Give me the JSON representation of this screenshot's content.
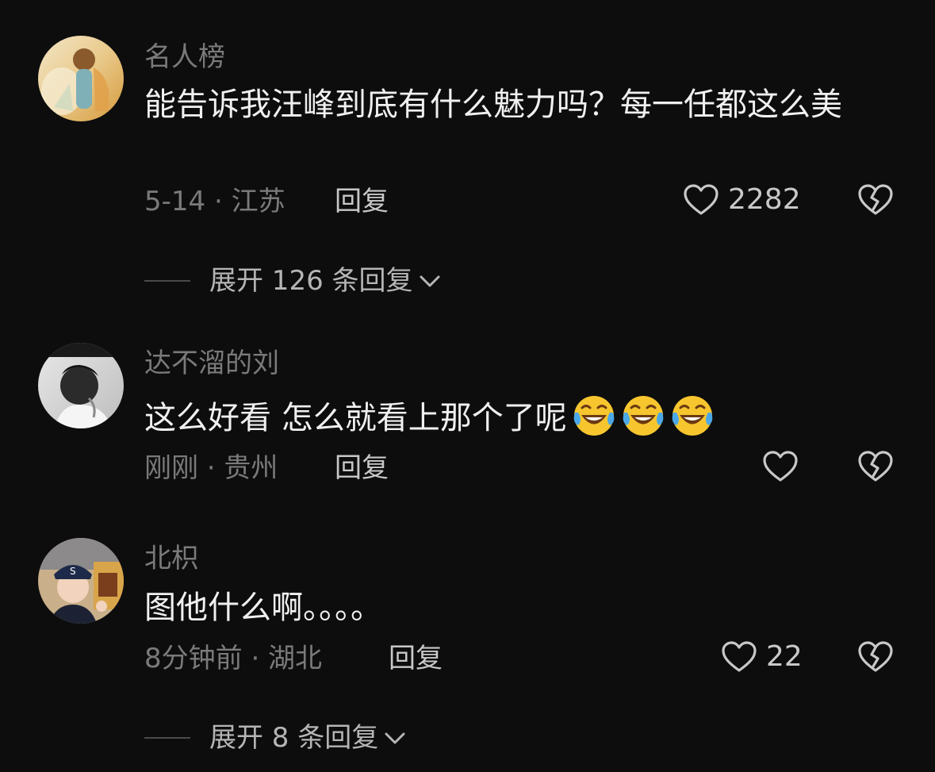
{
  "comments": [
    {
      "username": "名人榜",
      "text": "能告诉我汪峰到底有什么魅力吗？每一任都这么美",
      "meta": "5-14 · 江苏",
      "reply_label": "回复",
      "likes": "2282",
      "expand_label": "展开 126 条回复"
    },
    {
      "username": "达不溜的刘",
      "text": "这么好看 怎么就看上那个了呢",
      "emojis": [
        "laughing-crying-emoji",
        "laughing-crying-emoji",
        "laughing-crying-emoji"
      ],
      "meta": "刚刚 · 贵州",
      "reply_label": "回复",
      "likes": ""
    },
    {
      "username": "北枳",
      "text": "图他什么啊。。。。",
      "meta": "8分钟前 · 湖北",
      "reply_label": "回复",
      "likes": "22",
      "expand_label": "展开 8 条回复"
    }
  ],
  "colors": {
    "background": "#0d0d0d",
    "text": "#f0f0f0",
    "muted": "#7a7a7a",
    "action": "#c8c8c8"
  },
  "icons": {
    "like": "heart-outline-icon",
    "dislike": "broken-heart-icon",
    "expand": "chevron-down-icon"
  }
}
